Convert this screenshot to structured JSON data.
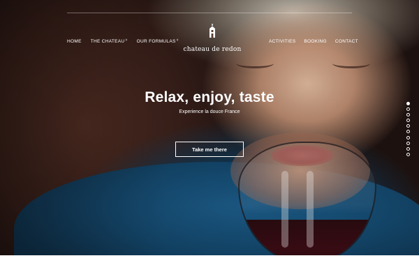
{
  "nav": {
    "left": [
      {
        "label": "HOME",
        "has_dropdown": false
      },
      {
        "label": "THE CHATEAU",
        "has_dropdown": true
      },
      {
        "label": "OUR FORMULAS",
        "has_dropdown": true
      }
    ],
    "right": [
      {
        "label": "ACTIVITIES"
      },
      {
        "label": "BOOKING"
      },
      {
        "label": "CONTACT"
      }
    ],
    "dropdown_glyph": "˅"
  },
  "logo": {
    "text": "chateau de redon",
    "icon": "castle-tower-icon"
  },
  "hero": {
    "headline": "Relax, enjoy, taste",
    "subline": "Experience la douce France",
    "cta_label": "Take me there",
    "slide_count": 10,
    "active_slide": 1
  },
  "colors": {
    "text": "#ffffff",
    "page_background": "#ffffff",
    "sweater": "#1d5f8e",
    "wine": "#3b0c14"
  }
}
